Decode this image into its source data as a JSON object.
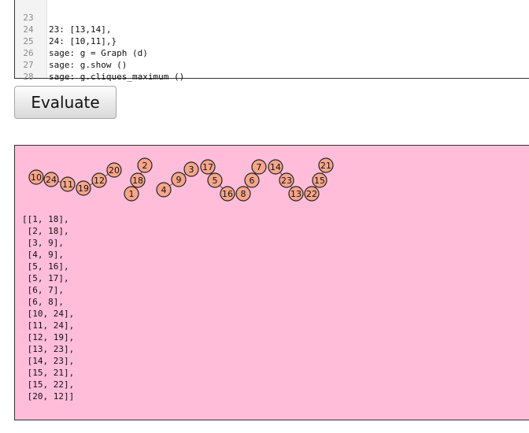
{
  "editor": {
    "lines": [
      {
        "num": "23",
        "text": "23: [13,14],"
      },
      {
        "num": "24",
        "text": "24: [10,11],}"
      },
      {
        "num": "25",
        "text": "sage: g = Graph (d)"
      },
      {
        "num": "26",
        "text": "sage: g.show ()"
      },
      {
        "num": "27",
        "text": "sage: g.cliques_maximum ()"
      },
      {
        "num": "28",
        "text": ""
      }
    ]
  },
  "evaluate_button": {
    "label": "Evaluate"
  },
  "output": {
    "background": "#ffbdd9",
    "node_fill": "#f7a58a",
    "node_stroke": "#222222",
    "nodes": [
      "1",
      "2",
      "3",
      "4",
      "5",
      "6",
      "7",
      "8",
      "9",
      "10",
      "11",
      "12",
      "13",
      "14",
      "15",
      "16",
      "17",
      "18",
      "19",
      "20",
      "21",
      "22",
      "23",
      "24"
    ],
    "edges": [
      [
        1,
        18
      ],
      [
        2,
        18
      ],
      [
        3,
        9
      ],
      [
        4,
        9
      ],
      [
        5,
        16
      ],
      [
        5,
        17
      ],
      [
        6,
        7
      ],
      [
        6,
        8
      ],
      [
        10,
        24
      ],
      [
        11,
        24
      ],
      [
        12,
        19
      ],
      [
        13,
        23
      ],
      [
        14,
        23
      ],
      [
        15,
        21
      ],
      [
        15,
        22
      ],
      [
        20,
        12
      ]
    ],
    "result_text": "[[1, 18],\n [2, 18],\n [3, 9],\n [4, 9],\n [5, 16],\n [5, 17],\n [6, 7],\n [6, 8],\n [10, 24],\n [11, 24],\n [12, 19],\n [13, 23],\n [14, 23],\n [15, 21],\n [15, 22],\n [20, 12]]"
  }
}
